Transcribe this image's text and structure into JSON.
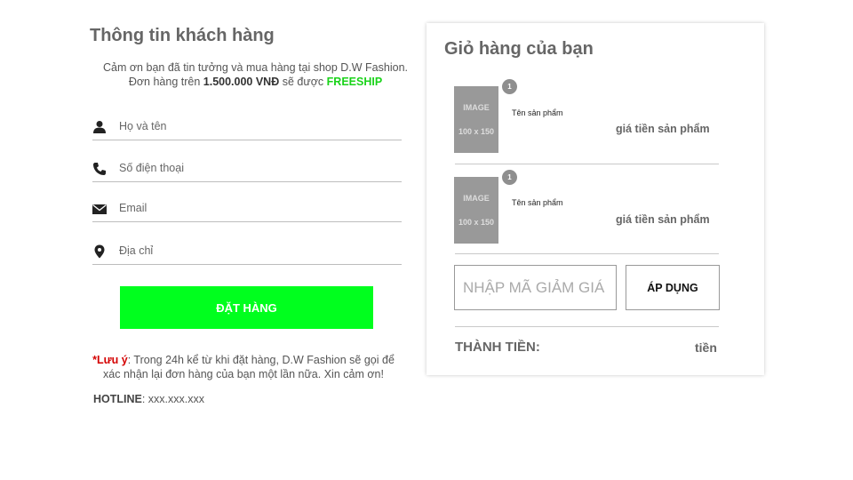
{
  "customer": {
    "title": "Thông tin khách hàng",
    "thanks": "Cảm ơn bạn đã tin tưởng và mua hàng tại shop D.W Fashion.",
    "freeship_prefix": "Đơn hàng trên",
    "freeship_amount": "1.500.000 VNĐ",
    "freeship_mid": "sẽ được",
    "freeship_word": "FREESHIP",
    "fields": {
      "name": {
        "placeholder": "Họ và tên",
        "icon": "user-icon"
      },
      "phone": {
        "placeholder": "Số điện thoại",
        "icon": "phone-icon"
      },
      "email": {
        "placeholder": "Email",
        "icon": "envelope-icon"
      },
      "address": {
        "placeholder": "Địa chỉ",
        "icon": "location-pin-icon"
      }
    },
    "order_button": "ĐẶT HÀNG",
    "note_star": "*",
    "note_label": "Lưu ý",
    "note_text": ": Trong 24h kể từ khi đặt hàng, D.W Fashion sẽ gọi để xác nhận lại đơn hàng của bạn một lần nữa. Xin cảm ơn!",
    "hotline_label": "HOTLINE",
    "hotline_value": ": xxx.xxx.xxx"
  },
  "cart": {
    "title": "Giỏ hàng của bạn",
    "items": [
      {
        "qty": "1",
        "image_line1": "IMAGE",
        "image_line2": "100 x 150",
        "name": "Tên sản phẩm",
        "price": "giá tiền sản phẩm"
      },
      {
        "qty": "1",
        "image_line1": "IMAGE",
        "image_line2": "100 x 150",
        "name": "Tên sản phẩm",
        "price": "giá tiền sản phẩm"
      }
    ],
    "coupon_placeholder": "NHẬP MÃ GIẢM GIÁ",
    "apply_button": "ÁP DỤNG",
    "total_label": "THÀNH TIỀN:",
    "total_value": "tiền"
  },
  "colors": {
    "accent_green": "#00ff1e",
    "freeship_green": "#19d319",
    "note_red": "#d40000"
  }
}
